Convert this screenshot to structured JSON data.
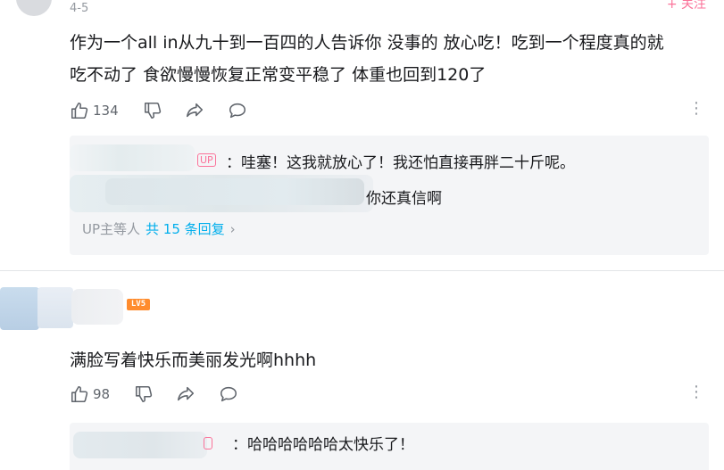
{
  "header": {
    "follow_label": "+ 关注"
  },
  "comments": [
    {
      "date": "4-5",
      "text": [
        "作为一个all in从九十到一百四的人告诉你 没事的 放心吃！吃到一个程度真的就",
        "吃不动了 食欲慢慢恢复正常变平稳了 体重也回到120了"
      ],
      "likes": "134",
      "replies": [
        {
          "badge": "UP",
          "text": "：哇塞！这我就放心了！我还怕直接再胖二十斤呢。"
        },
        {
          "text": "你还真信啊"
        }
      ],
      "reply_summary": {
        "prefix": "UP主等人",
        "count_link": "共 15 条回复",
        "chevron": "›"
      }
    },
    {
      "level": "LV5",
      "text": "满脸写着快乐而美丽发光啊hhhh",
      "likes": "98",
      "replies": [
        {
          "text": "：哈哈哈哈哈哈太快乐了！"
        }
      ]
    }
  ],
  "icons": [
    "like-icon",
    "dislike-icon",
    "share-icon",
    "reply-icon",
    "more-icon",
    "chevron-right-icon"
  ],
  "colors": {
    "accent_pink": "#fb7299",
    "link_blue": "#00aeec",
    "muted_gray": "#9499a0",
    "level_orange": "#ff8c2e",
    "reply_bg": "#f4f5f7"
  }
}
